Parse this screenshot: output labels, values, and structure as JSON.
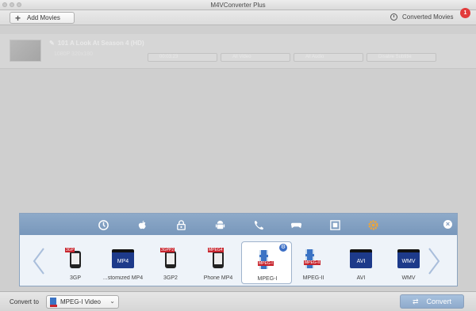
{
  "window": {
    "title": "M4VConverter Plus"
  },
  "toolbar": {
    "add_movies_label": "Add Movies",
    "converted_movies_label": "Converted Movies",
    "converted_badge": "1"
  },
  "movie": {
    "title": "101 A Look At Season 4 (HD)",
    "subtitle": "1080P    320x180",
    "duration": "00:03:23",
    "video_select": "All Video",
    "audio_select": "All Audio",
    "subtitle_select": "Disable Subtitle"
  },
  "popup": {
    "categories": [
      "recent-icon",
      "apple-icon",
      "drm-icon",
      "android-icon",
      "phone-icon",
      "game-icon",
      "film-icon",
      "settings-icon"
    ],
    "formats": [
      {
        "label": "3GP",
        "tag": "3GP",
        "kind": "phone"
      },
      {
        "label": "...stomized MP4",
        "tag": "MP4",
        "kind": "clap"
      },
      {
        "label": "3GP2",
        "tag": "3GPP2",
        "kind": "phone"
      },
      {
        "label": "Phone MP4",
        "tag": "MPEG4",
        "kind": "phone"
      },
      {
        "label": "MPEG-I",
        "tag": "MPEG-I",
        "kind": "film"
      },
      {
        "label": "MPEG-II",
        "tag": "MPEG-II",
        "kind": "film"
      },
      {
        "label": "AVI",
        "tag": "AVI",
        "kind": "clap"
      },
      {
        "label": "WMV",
        "tag": "WMV",
        "kind": "clap"
      }
    ],
    "selected_format": "MPEG-I"
  },
  "bottom": {
    "convert_to_label": "Convert to",
    "selected_format": "MPEG-I Video",
    "convert_label": "Convert"
  },
  "colors": {
    "accent": "#7f9cc0",
    "badge": "#e23b3b",
    "tag_red": "#c8252e",
    "clap_blue": "#1d3a8a"
  }
}
